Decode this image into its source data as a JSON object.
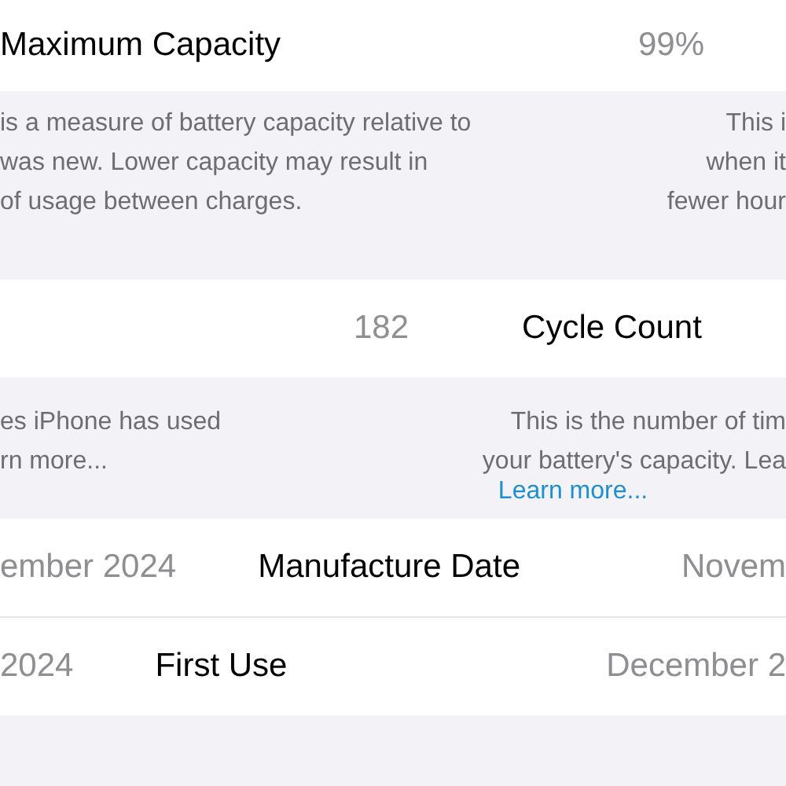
{
  "capacity": {
    "label": "Maximum Capacity",
    "value": "99%"
  },
  "capacity_note": {
    "left": [
      "is a measure of battery capacity relative to",
      "was new. Lower capacity may result in",
      "of usage between charges."
    ],
    "right": [
      "This i",
      "when it",
      "fewer hour"
    ]
  },
  "cycles": {
    "value": "182",
    "label": "Cycle Count"
  },
  "cycles_note": {
    "left": [
      "es iPhone has used",
      "rn more..."
    ],
    "right": [
      "This is the number of tim",
      "your battery's capacity. Lea"
    ],
    "link": "Learn more..."
  },
  "manufacture": {
    "left_value": "ember 2024",
    "label": "Manufacture Date",
    "value": "Novem"
  },
  "first_use": {
    "left_value": "2024",
    "label": "First Use",
    "value": "December 2"
  }
}
